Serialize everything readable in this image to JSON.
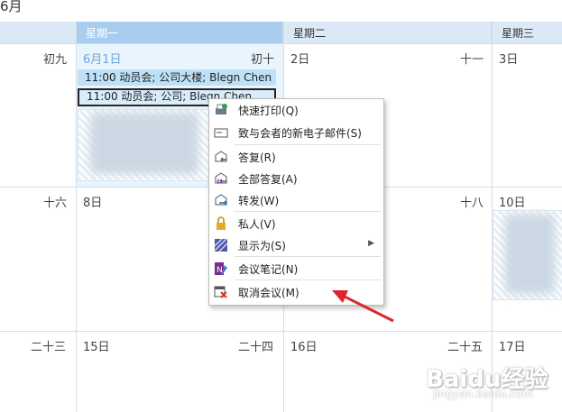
{
  "calendar": {
    "month_title": "6月",
    "weekdays": [
      "星期一",
      "星期二",
      "星期三"
    ],
    "week1": {
      "lunar_prev": "初九",
      "mon_date": "6月1日",
      "mon_lunar": "初十",
      "tue_date": "2日",
      "tue_lunar": "十一",
      "wed_date": "3日"
    },
    "week2": {
      "lunar_prev": "十六",
      "mon_date": "8日",
      "tue_lunar": "十八",
      "wed_date": "10日"
    },
    "week3": {
      "lunar_prev": "二十三",
      "mon_date": "15日",
      "mon_lunar": "二十四",
      "tue_date": "16日",
      "tue_lunar": "二十五",
      "wed_date": "17日"
    },
    "appointments": [
      "11:00 动员会; 公司大楼; Blegn Chen",
      "11:00 动员会; 公司; Blegn Chen"
    ]
  },
  "context_menu": {
    "items": [
      {
        "label": "快速打印(Q)",
        "icon": "quick-print-icon"
      },
      {
        "label": "致与会者的新电子邮件(S)",
        "icon": "email-icon"
      },
      {
        "label": "答复(R)",
        "icon": "reply-icon"
      },
      {
        "label": "全部答复(A)",
        "icon": "reply-all-icon"
      },
      {
        "label": "转发(W)",
        "icon": "forward-icon"
      },
      {
        "label": "私人(V)",
        "icon": "lock-icon"
      },
      {
        "label": "显示为(S)",
        "icon": "show-as-icon"
      },
      {
        "label": "会议笔记(N)",
        "icon": "onenote-icon"
      },
      {
        "label": "取消会议(M)",
        "icon": "cancel-meeting-icon"
      }
    ]
  },
  "watermark": {
    "main": "Baidu经验",
    "sub": "jingyan.baidu.com"
  },
  "colors": {
    "header": "#dbe8f6",
    "header_selected": "#a9cdef",
    "appointment": "#bfe1f7",
    "arrow": "#e0242a"
  }
}
